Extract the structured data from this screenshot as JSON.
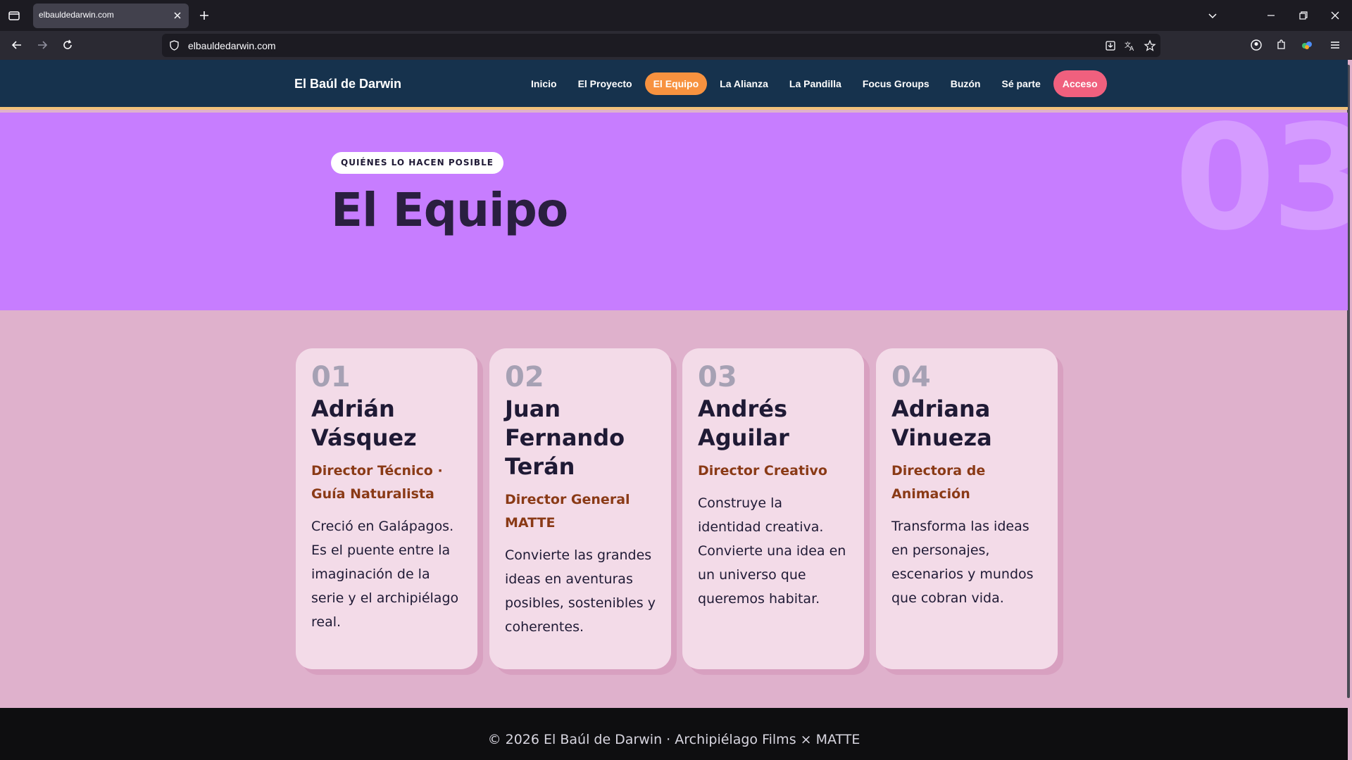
{
  "browser": {
    "tab_title": "elbauldedarwin.com",
    "url": "elbauldedarwin.com"
  },
  "site": {
    "brand": "El Baúl de Darwin",
    "menu": [
      {
        "label": "Inicio",
        "active": false
      },
      {
        "label": "El Proyecto",
        "active": false
      },
      {
        "label": "El Equipo",
        "active": true
      },
      {
        "label": "La Alianza",
        "active": false
      },
      {
        "label": "La Pandilla",
        "active": false
      },
      {
        "label": "Focus Groups",
        "active": false
      },
      {
        "label": "Buzón",
        "active": false
      },
      {
        "label": "Sé parte",
        "active": false
      }
    ],
    "cta_label": "Acceso"
  },
  "hero": {
    "eyebrow": "QUIÉNES LO HACEN POSIBLE",
    "title": "El Equipo",
    "section_number": "03"
  },
  "team": [
    {
      "num": "01",
      "name": "Adrián Vásquez",
      "role": "Director Técnico · Guía Naturalista",
      "bio": "Creció en Galápagos. Es el puente entre la imaginación de la serie y el archipiélago real."
    },
    {
      "num": "02",
      "name": "Juan Fernando Terán",
      "role": "Director General MATTE",
      "bio": "Convierte las grandes ideas en aventuras posibles, sostenibles y coherentes."
    },
    {
      "num": "03",
      "name": "Andrés Aguilar",
      "role": "Director Creativo",
      "bio": "Construye la identidad creativa. Convierte una idea en un universo que queremos habitar."
    },
    {
      "num": "04",
      "name": "Adriana Vinueza",
      "role": "Directora de Animación",
      "bio": "Transforma las ideas en personajes, escenarios y mundos que cobran vida."
    }
  ],
  "footer": {
    "text": "© 2026 El Baúl de Darwin · Archipiélago Films × MATTE"
  },
  "colors": {
    "header_bg": "#16324d",
    "hero_bg": "#c77dff",
    "page_bg": "#dfb1cc",
    "card_bg": "#f3dbe8",
    "active_nav": "#f7923f",
    "cta": "#f0607e",
    "role_text": "#8a3a16",
    "footer_bg": "#0e0e10"
  }
}
